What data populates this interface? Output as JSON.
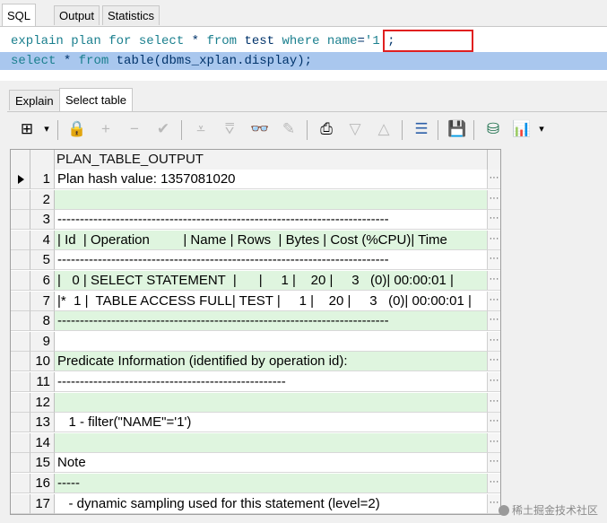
{
  "top_tabs": [
    {
      "label": "SQL",
      "active": true
    },
    {
      "label": "Output",
      "active": false
    },
    {
      "label": "Statistics",
      "active": false
    }
  ],
  "editor": {
    "line1": {
      "kw1": "explain plan for select",
      "star": " * ",
      "kw2": "from",
      "tbl": " test ",
      "kw3": "where",
      "space": " ",
      "cond_name": "name",
      "cond_eq": "=",
      "cond_val": "'1'",
      "semi": ";"
    },
    "line2": {
      "kw1": "select",
      "star": " * ",
      "kw2": "from",
      "rest": " table(dbms_xplan.display);"
    }
  },
  "bottom_tabs": [
    {
      "label": "Explain",
      "active": false
    },
    {
      "label": "Select table",
      "active": true
    }
  ],
  "toolbar": {
    "icons": [
      "grid-layout-icon",
      "lock-icon",
      "add-icon",
      "remove-icon",
      "post-check-icon",
      "first-record-icon",
      "last-record-icon",
      "binoculars-icon",
      "eraser-icon",
      "export-icon",
      "filter-down-icon",
      "filter-up-icon",
      "tree-icon",
      "save-icon",
      "database-icon",
      "chart-icon"
    ],
    "grid_glyph": "⊞",
    "lock_glyph": "🔒",
    "add_glyph": "+",
    "remove_glyph": "−",
    "check_glyph": "✔",
    "first_glyph": "⩡",
    "last_glyph": "⩢",
    "find_glyph": "👓",
    "eraser_glyph": "✎",
    "export_glyph": "⎙",
    "down_glyph": "▽",
    "up_glyph": "△",
    "tree_glyph": "☰",
    "save_glyph": "💾",
    "db_glyph": "⛁",
    "chart_glyph": "📊",
    "dropdown_glyph": "▾"
  },
  "grid": {
    "column_header": "PLAN_TABLE_OUTPUT",
    "ellipsis": "···",
    "rows": [
      {
        "n": "1",
        "text": "Plan hash value: 1357081020",
        "current": true
      },
      {
        "n": "2",
        "text": ""
      },
      {
        "n": "3",
        "text": "--------------------------------------------------------------------------"
      },
      {
        "n": "4",
        "text": "| Id  | Operation         | Name | Rows  | Bytes | Cost (%CPU)| Time"
      },
      {
        "n": "5",
        "text": "--------------------------------------------------------------------------"
      },
      {
        "n": "6",
        "text": "|   0 | SELECT STATEMENT  |      |     1 |    20 |     3   (0)| 00:00:01 |"
      },
      {
        "n": "7",
        "text": "|*  1 |  TABLE ACCESS FULL| TEST |     1 |    20 |     3   (0)| 00:00:01 |"
      },
      {
        "n": "8",
        "text": "--------------------------------------------------------------------------"
      },
      {
        "n": "9",
        "text": ""
      },
      {
        "n": "10",
        "text": "Predicate Information (identified by operation id):"
      },
      {
        "n": "11",
        "text": "---------------------------------------------------"
      },
      {
        "n": "12",
        "text": ""
      },
      {
        "n": "13",
        "text": "   1 - filter(\"NAME\"='1')"
      },
      {
        "n": "14",
        "text": ""
      },
      {
        "n": "15",
        "text": "Note"
      },
      {
        "n": "16",
        "text": "-----"
      },
      {
        "n": "17",
        "text": "   - dynamic sampling used for this statement (level=2)"
      }
    ]
  },
  "watermark": "稀土掘金技术社区"
}
